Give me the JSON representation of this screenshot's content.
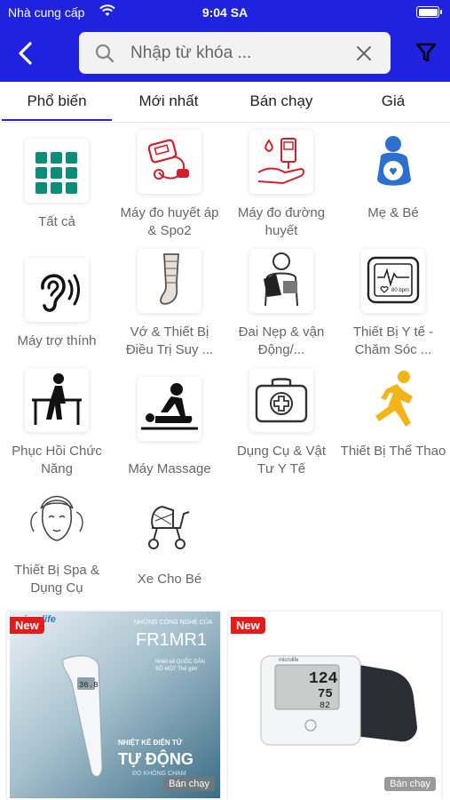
{
  "status_bar": {
    "carrier": "Nhà cung cấp",
    "time": "9:04 SA"
  },
  "header": {
    "search_placeholder": "Nhập từ khóa ...",
    "brand_color": "#1f23e0"
  },
  "tabs": [
    {
      "label": "Phổ biến",
      "active": true
    },
    {
      "label": "Mới nhất"
    },
    {
      "label": "Bán chạy"
    },
    {
      "label": "Giá"
    }
  ],
  "categories": [
    {
      "label": "Tất cả",
      "icon": "grid-icon"
    },
    {
      "label": "Máy đo huyết áp & Spo2",
      "icon": "blood-pressure-icon"
    },
    {
      "label": "Máy đo đường huyết",
      "icon": "glucose-icon"
    },
    {
      "label": "Mẹ & Bé",
      "icon": "mother-baby-icon"
    },
    {
      "label": "Máy trợ thính",
      "icon": "ear-icon"
    },
    {
      "label": "Vớ & Thiết Bị Điều Trị Suy ...",
      "icon": "compression-stocking-icon"
    },
    {
      "label": "Đai Nẹp & vận Động/...",
      "icon": "arm-brace-icon"
    },
    {
      "label": "Thiết Bị Y tế - Chăm Sóc ...",
      "icon": "heart-monitor-icon"
    },
    {
      "label": "Phục Hồi Chức Năng",
      "icon": "rehab-icon"
    },
    {
      "label": "Máy Massage",
      "icon": "massage-icon"
    },
    {
      "label": "Dụng Cụ & Vật Tư Y Tế",
      "icon": "first-aid-icon"
    },
    {
      "label": "Thiết Bị Thể Thao",
      "icon": "runner-icon"
    },
    {
      "label": "Thiết Bị Spa & Dụng Cụ",
      "icon": "spa-icon"
    },
    {
      "label": "Xe Cho Bé",
      "icon": "stroller-icon"
    }
  ],
  "products": [
    {
      "badge": "New",
      "tag": "Bán chạy",
      "brand": "microlife",
      "headline": "NHỮNG CÔNG NGHỆ CỦA",
      "model": "FR1MR1",
      "subtitle": "Nhiệt kế QUỐC DÂN",
      "subtitle2": "SỐ MỘT Thế giới",
      "banner1": "NHIỆT KẾ ĐIỆN TỬ",
      "banner2": "TỰ ĐỘNG",
      "banner3": "ĐO KHÔNG CHẠM",
      "reading": "36.8"
    },
    {
      "badge": "New",
      "tag": "Bán chạy",
      "brand": "microlife",
      "sys": "124",
      "dia": "75",
      "pulse": "82"
    }
  ]
}
